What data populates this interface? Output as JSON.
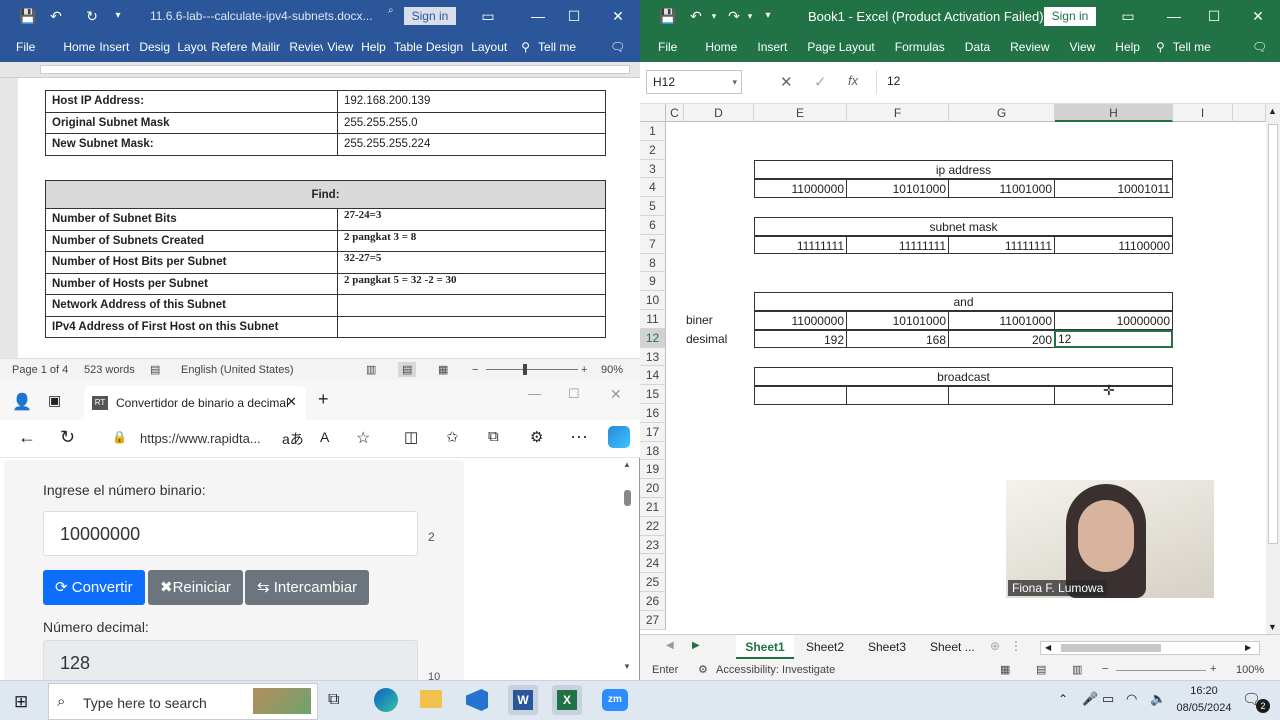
{
  "word": {
    "filename": "11.6.6-lab---calculate-ipv4-subnets.docx...",
    "signin": "Sign in",
    "tabs": [
      "File",
      "Home",
      "Insert",
      "Desig",
      "Layou",
      "Refere",
      "Mailir",
      "Reviev",
      "View",
      "Help",
      "Table Design",
      "Layout"
    ],
    "tellme": "Tell me",
    "table1": [
      {
        "k": "Host IP Address:",
        "v": "192.168.200.139"
      },
      {
        "k": "Original Subnet Mask",
        "v": "255.255.255.0"
      },
      {
        "k": "New Subnet Mask:",
        "v": "255.255.255.224"
      }
    ],
    "find_header": "Find:",
    "table2": [
      {
        "k": "Number of Subnet Bits",
        "v": "27-24=3"
      },
      {
        "k": "Number of Subnets Created",
        "v": "2 pangkat 3 = 8"
      },
      {
        "k": "Number of Host Bits per Subnet",
        "v": "32-27=5"
      },
      {
        "k": "Number of Hosts per Subnet",
        "v": "2 pangkat 5 = 32 -2 = 30"
      },
      {
        "k": "Network Address of this Subnet",
        "v": ""
      },
      {
        "k": "IPv4 Address of First Host on this Subnet",
        "v": ""
      }
    ],
    "status": {
      "page": "Page 1 of 4",
      "words": "523 words",
      "lang": "English (United States)",
      "zoom": "90%"
    }
  },
  "edge": {
    "tab_title": "Convertidor de binario a decimal",
    "url": "https://www.rapidta...",
    "input_label": "Ingrese el número binario:",
    "input_value": "10000000",
    "base": "2",
    "btn_convert": "Convertir",
    "btn_reset": "Reiniciar",
    "btn_swap": "Intercambiar",
    "output_label": "Número decimal:",
    "output_value": "128",
    "output_base": "10",
    "colors": {
      "convert": "#0d6efd",
      "gray": "#6c757d"
    }
  },
  "excel": {
    "title": "Book1 - Excel (Product Activation Failed)",
    "signin": "Sign in",
    "tabs": [
      "File",
      "Home",
      "Insert",
      "Page Layout",
      "Formulas",
      "Data",
      "Review",
      "View",
      "Help"
    ],
    "tellme": "Tell me",
    "namebox": "H12",
    "formula": "12",
    "columns": [
      "C",
      "D",
      "E",
      "F",
      "G",
      "H",
      "I"
    ],
    "rows": [
      "1",
      "2",
      "3",
      "4",
      "5",
      "6",
      "7",
      "8",
      "9",
      "10",
      "11",
      "12",
      "13",
      "14",
      "15",
      "16",
      "17",
      "18",
      "19",
      "20",
      "21",
      "22",
      "23",
      "24",
      "25",
      "26",
      "27"
    ],
    "ip_label": "ip address",
    "ip": [
      "11000000",
      "10101000",
      "11001000",
      "10001011"
    ],
    "mask_label": "subnet mask",
    "mask": [
      "11111111",
      "11111111",
      "11111111",
      "11100000"
    ],
    "and_label": "and",
    "biner_label": "biner",
    "biner": [
      "11000000",
      "10101000",
      "11001000",
      "10000000"
    ],
    "desimal_label": "desimal",
    "desimal": [
      "192",
      "168",
      "200",
      "12"
    ],
    "broadcast_label": "broadcast",
    "sheets": [
      "Sheet1",
      "Sheet2",
      "Sheet3",
      "Sheet ..."
    ],
    "status_mode": "Enter",
    "accessibility": "Accessibility: Investigate",
    "zoom": "100%",
    "participant": "Fiona F. Lumowa"
  },
  "taskbar": {
    "search_placeholder": "Type here to search",
    "time": "16:20",
    "date": "08/05/2024",
    "notif_count": "2"
  }
}
